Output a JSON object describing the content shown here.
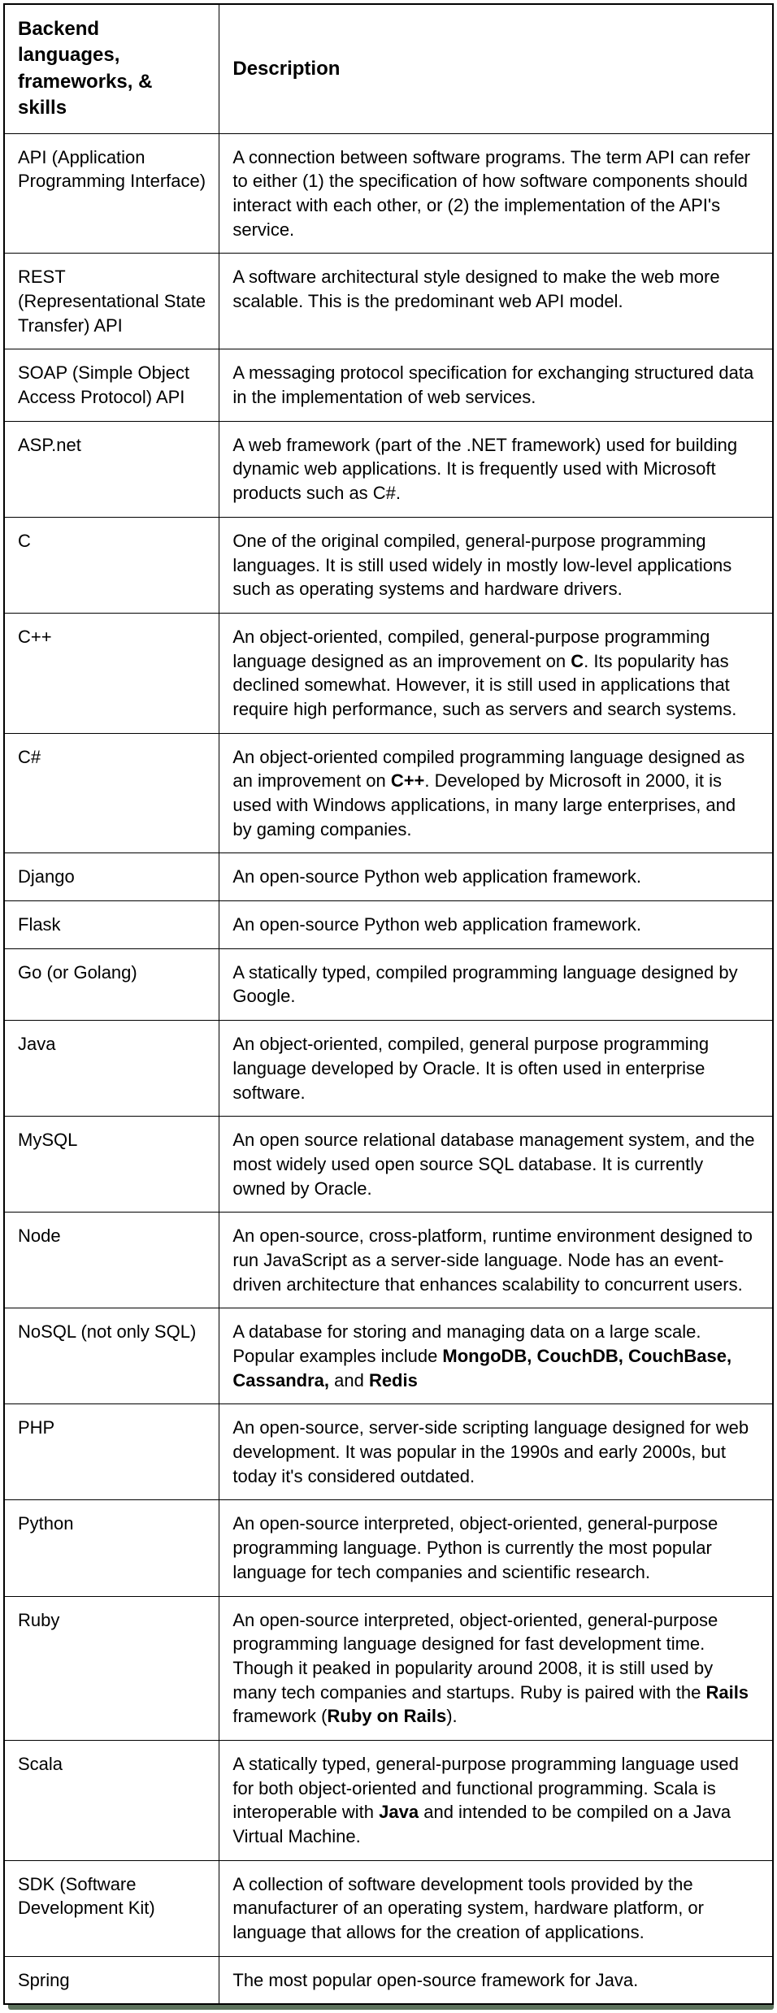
{
  "headers": {
    "col0": "Backend languages, frameworks, & skills",
    "col1": "Description"
  },
  "rows": [
    {
      "term": "API (Application Programming Interface)",
      "desc": [
        "A connection between software programs. The term API can refer to either (1) the specification of how software components should interact with each other, or (2) the implementation of the API's service."
      ]
    },
    {
      "term": "REST (Representational State Transfer) API",
      "desc": [
        "A software architectural style designed to make the web more scalable. This is the predominant web API model."
      ]
    },
    {
      "term": "SOAP (Simple Object Access Protocol) API",
      "desc": [
        "A messaging protocol specification for exchanging structured data in the implementation of web services."
      ]
    },
    {
      "term": "ASP.net",
      "desc": [
        "A web framework (part of the .NET framework) used for building dynamic web applications. It is frequently used with Microsoft products such as C#."
      ]
    },
    {
      "term": "C",
      "desc": [
        "One of the original compiled, general-purpose programming languages. It is still used widely in mostly low-level applications such as operating systems and hardware drivers."
      ]
    },
    {
      "term": "C++",
      "desc": [
        "An object-oriented, compiled, general-purpose programming language designed as an improvement on ",
        {
          "b": "C"
        },
        ". Its popularity has declined somewhat. However, it is still used in applications that require high performance, such as servers and search systems."
      ]
    },
    {
      "term": "C#",
      "desc": [
        "An object-oriented compiled programming language designed as an improvement on ",
        {
          "b": "C++"
        },
        ". Developed by Microsoft in 2000, it is used with Windows applications, in many large enterprises, and by gaming companies."
      ]
    },
    {
      "term": "Django",
      "desc": [
        "An open-source Python web application framework."
      ]
    },
    {
      "term": "Flask",
      "desc": [
        "An open-source Python web application framework."
      ]
    },
    {
      "term": "Go (or Golang)",
      "desc": [
        "A statically typed, compiled programming language designed by Google."
      ]
    },
    {
      "term": "Java",
      "desc": [
        "An object-oriented, compiled, general purpose programming language developed by Oracle. It is often used in enterprise software."
      ]
    },
    {
      "term": "MySQL",
      "desc": [
        "An open source relational database management system, and the most widely used open source SQL database. It is currently owned by Oracle."
      ]
    },
    {
      "term": "Node",
      "desc": [
        "An open-source, cross-platform, runtime environment designed to run JavaScript as a server-side language. Node has an event-driven architecture that enhances scalability to concurrent users."
      ]
    },
    {
      "term": "NoSQL (not only SQL)",
      "desc": [
        "A database for storing and managing data on a large scale. Popular examples include ",
        {
          "b": "MongoDB, CouchDB, CouchBase, Cassandra,"
        },
        " and ",
        {
          "b": "Redis"
        }
      ]
    },
    {
      "term": "PHP",
      "desc": [
        "An open-source, server-side scripting language designed for web development. It was popular in the 1990s and early 2000s, but today it's considered outdated."
      ]
    },
    {
      "term": "Python",
      "desc": [
        "An open-source interpreted, object-oriented, general-purpose programming language. Python is currently the most popular language for tech companies and scientific research."
      ]
    },
    {
      "term": "Ruby",
      "desc": [
        "An open-source interpreted, object-oriented, general-purpose programming language designed for fast development time. Though it peaked in popularity around 2008, it is still used by many tech companies and startups. Ruby is paired with the ",
        {
          "b": "Rails"
        },
        " framework (",
        {
          "b": "Ruby on Rails"
        },
        ")."
      ]
    },
    {
      "term": "Scala",
      "desc": [
        "A statically typed, general-purpose programming language used for both object-oriented and functional programming. Scala is interoperable with ",
        {
          "b": "Java"
        },
        " and intended to be compiled on a Java Virtual Machine."
      ]
    },
    {
      "term": "SDK (Software Development Kit)",
      "desc": [
        "A collection of software development tools provided by the manufacturer of an operating system, hardware platform, or language that allows for the creation of applications."
      ]
    },
    {
      "term": "Spring",
      "desc": [
        "The most popular open-source framework for Java."
      ]
    }
  ]
}
